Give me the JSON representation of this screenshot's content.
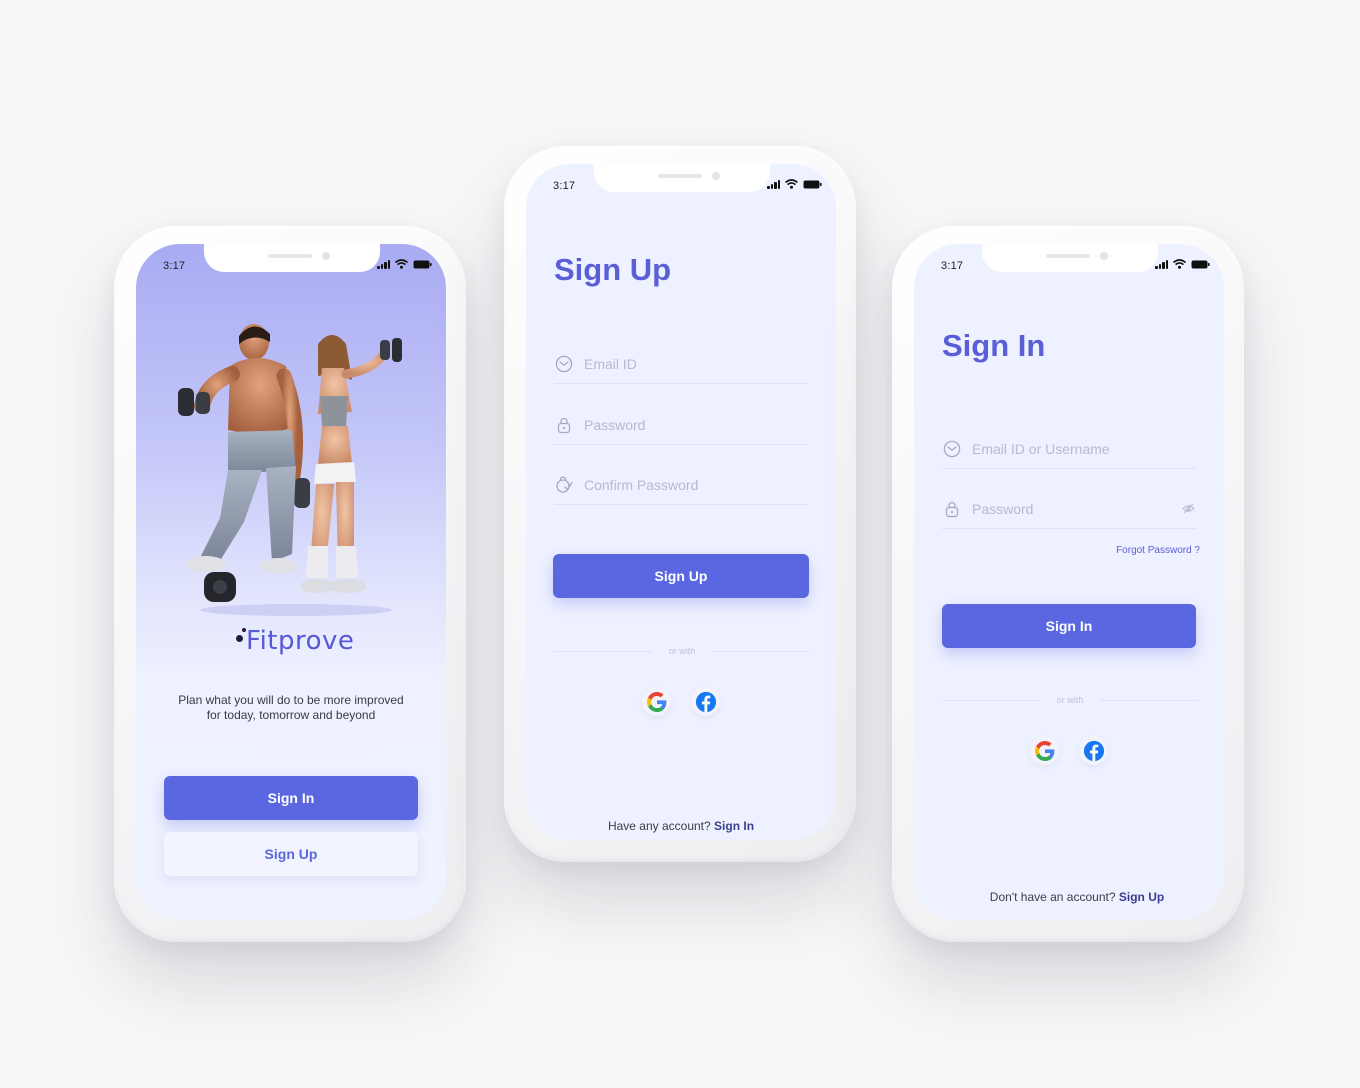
{
  "status_bar": {
    "time": "3:17"
  },
  "welcome": {
    "brand": "Fitprove",
    "tagline_line1": "Plan what you will do to be more improved",
    "tagline_line2": "for today, tomorrow and beyond",
    "sign_in_label": "Sign In",
    "sign_up_label": "Sign Up"
  },
  "sign_up": {
    "title": "Sign Up",
    "email_placeholder": "Email ID",
    "password_placeholder": "Password",
    "confirm_password_placeholder": "Confirm Password",
    "submit_label": "Sign Up",
    "divider_text": "or with",
    "footer_prompt": "Have any account?",
    "footer_link": "Sign In"
  },
  "sign_in": {
    "title": "Sign In",
    "email_placeholder": "Email ID or Username",
    "password_placeholder": "Password",
    "forgot_label": "Forgot Password ?",
    "submit_label": "Sign In",
    "divider_text": "or with",
    "footer_prompt": "Don't have an account?",
    "footer_link": "Sign Up"
  },
  "colors": {
    "primary": "#5a67e0",
    "title": "#5a5fd8",
    "screen_bg": "#eef1ff",
    "page_bg": "#f7f7f8"
  },
  "icons": [
    "mail-icon",
    "lock-icon",
    "user-check-icon",
    "eye-off-icon",
    "google-icon",
    "facebook-icon",
    "signal-icon",
    "wifi-icon",
    "battery-icon"
  ]
}
